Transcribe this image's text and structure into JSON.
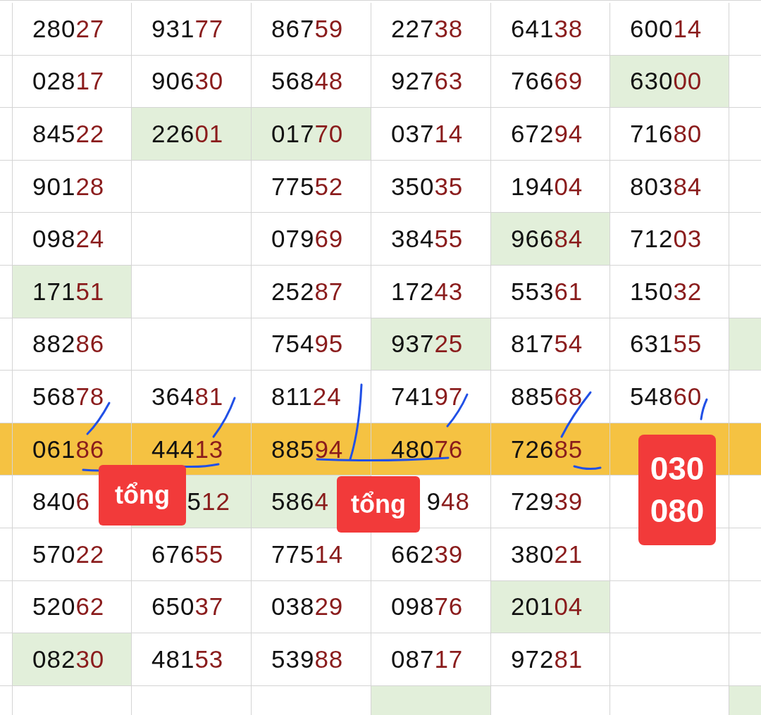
{
  "rows": [
    {
      "highlighted": false,
      "cells": [
        {
          "head": "280",
          "tail": "27",
          "green": false
        },
        {
          "head": "931",
          "tail": "77",
          "green": false
        },
        {
          "head": "867",
          "tail": "59",
          "green": false
        },
        {
          "head": "227",
          "tail": "38",
          "green": false
        },
        {
          "head": "641",
          "tail": "38",
          "green": false
        },
        {
          "head": "600",
          "tail": "14",
          "green": false
        },
        {
          "green": false
        }
      ]
    },
    {
      "highlighted": false,
      "cells": [
        {
          "head": "028",
          "tail": "17",
          "green": false
        },
        {
          "head": "906",
          "tail": "30",
          "green": false
        },
        {
          "head": "568",
          "tail": "48",
          "green": false
        },
        {
          "head": "927",
          "tail": "63",
          "green": false
        },
        {
          "head": "766",
          "tail": "69",
          "green": false
        },
        {
          "head": "630",
          "tail": "00",
          "green": true
        },
        {
          "green": false
        }
      ]
    },
    {
      "highlighted": false,
      "cells": [
        {
          "head": "845",
          "tail": "22",
          "green": false
        },
        {
          "head": "226",
          "tail": "01",
          "green": true
        },
        {
          "head": "017",
          "tail": "70",
          "green": true
        },
        {
          "head": "037",
          "tail": "14",
          "green": false
        },
        {
          "head": "672",
          "tail": "94",
          "green": false
        },
        {
          "head": "716",
          "tail": "80",
          "green": false
        },
        {
          "green": false
        }
      ]
    },
    {
      "highlighted": false,
      "cells": [
        {
          "head": "901",
          "tail": "28",
          "green": false
        },
        {
          "green": false
        },
        {
          "head": "775",
          "tail": "52",
          "green": false
        },
        {
          "head": "350",
          "tail": "35",
          "green": false
        },
        {
          "head": "194",
          "tail": "04",
          "green": false
        },
        {
          "head": "803",
          "tail": "84",
          "green": false
        },
        {
          "green": false
        }
      ]
    },
    {
      "highlighted": false,
      "cells": [
        {
          "head": "098",
          "tail": "24",
          "green": false
        },
        {
          "green": false
        },
        {
          "head": "079",
          "tail": "69",
          "green": false
        },
        {
          "head": "384",
          "tail": "55",
          "green": false
        },
        {
          "head": "966",
          "tail": "84",
          "green": true
        },
        {
          "head": "712",
          "tail": "03",
          "green": false
        },
        {
          "green": false
        }
      ]
    },
    {
      "highlighted": false,
      "cells": [
        {
          "head": "171",
          "tail": "51",
          "green": true
        },
        {
          "green": false
        },
        {
          "head": "252",
          "tail": "87",
          "green": false
        },
        {
          "head": "172",
          "tail": "43",
          "green": false
        },
        {
          "head": "553",
          "tail": "61",
          "green": false
        },
        {
          "head": "150",
          "tail": "32",
          "green": false
        },
        {
          "green": false
        }
      ]
    },
    {
      "highlighted": false,
      "cells": [
        {
          "head": "882",
          "tail": "86",
          "green": false
        },
        {
          "green": false
        },
        {
          "head": "754",
          "tail": "95",
          "green": false
        },
        {
          "head": "937",
          "tail": "25",
          "green": true
        },
        {
          "head": "817",
          "tail": "54",
          "green": false
        },
        {
          "head": "631",
          "tail": "55",
          "green": false
        },
        {
          "green": true
        }
      ]
    },
    {
      "highlighted": false,
      "cells": [
        {
          "head": "568",
          "tail": "78",
          "green": false
        },
        {
          "head": "364",
          "tail": "81",
          "green": false
        },
        {
          "head": "811",
          "tail": "24",
          "green": false
        },
        {
          "head": "741",
          "tail": "97",
          "green": false
        },
        {
          "head": "885",
          "tail": "68",
          "green": false
        },
        {
          "head": "548",
          "tail": "60",
          "green": false
        },
        {
          "green": false
        }
      ]
    },
    {
      "highlighted": true,
      "cells": [
        {
          "head": "061",
          "tail": "86",
          "green": false
        },
        {
          "head": "444",
          "tail": "13",
          "green": false
        },
        {
          "head": "885",
          "tail": "94",
          "green": false
        },
        {
          "head": "480",
          "tail": "76",
          "green": false
        },
        {
          "head": "726",
          "tail": "85",
          "green": false
        },
        {
          "green": false
        },
        {
          "green": false
        }
      ]
    },
    {
      "highlighted": false,
      "cells": [
        {
          "head": "840",
          "tail": "6",
          "green": false
        },
        {
          "kind": "start_covered",
          "head": "5",
          "tail": "12",
          "green": true
        },
        {
          "head": "586",
          "tail": "4",
          "green": true
        },
        {
          "kind": "start_covered",
          "head": "9",
          "tail": "48",
          "green": false
        },
        {
          "head": "729",
          "tail": "39",
          "green": false
        },
        {
          "green": false
        },
        {
          "green": false
        }
      ]
    },
    {
      "highlighted": false,
      "cells": [
        {
          "head": "570",
          "tail": "22",
          "green": false
        },
        {
          "head": "676",
          "tail": "55",
          "green": false
        },
        {
          "head": "775",
          "tail": "14",
          "green": false
        },
        {
          "head": "662",
          "tail": "39",
          "green": false
        },
        {
          "head": "380",
          "tail": "21",
          "green": false
        },
        {
          "green": false
        },
        {
          "green": false
        }
      ]
    },
    {
      "highlighted": false,
      "cells": [
        {
          "head": "520",
          "tail": "62",
          "green": false
        },
        {
          "head": "650",
          "tail": "37",
          "green": false
        },
        {
          "head": "038",
          "tail": "29",
          "green": false
        },
        {
          "head": "098",
          "tail": "76",
          "green": false
        },
        {
          "head": "201",
          "tail": "04",
          "green": true
        },
        {
          "green": false
        },
        {
          "green": false
        }
      ]
    },
    {
      "highlighted": false,
      "cells": [
        {
          "head": "082",
          "tail": "30",
          "green": true
        },
        {
          "head": "481",
          "tail": "53",
          "green": false
        },
        {
          "head": "539",
          "tail": "88",
          "green": false
        },
        {
          "head": "087",
          "tail": "17",
          "green": false
        },
        {
          "head": "972",
          "tail": "81",
          "green": false
        },
        {
          "green": false
        },
        {
          "green": false
        }
      ]
    },
    {
      "highlighted": false,
      "cells": [
        {
          "green": false
        },
        {
          "green": false
        },
        {
          "green": false
        },
        {
          "green": true
        },
        {
          "green": false
        },
        {
          "green": false
        },
        {
          "green": true
        }
      ]
    }
  ],
  "labels": [
    {
      "kind": "sum",
      "lines": [
        "tổng"
      ]
    },
    {
      "kind": "sum",
      "lines": [
        "tổng"
      ]
    },
    {
      "kind": "result",
      "lines": [
        "030",
        "080"
      ]
    }
  ]
}
